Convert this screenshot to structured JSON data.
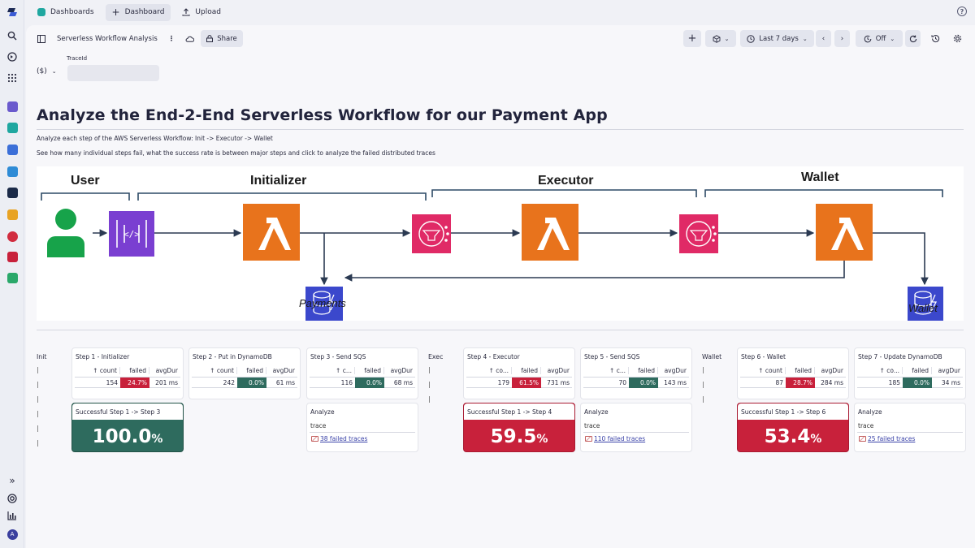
{
  "topnav": {
    "dashboards": "Dashboards",
    "dashboard": "Dashboard",
    "upload": "Upload"
  },
  "toolbar": {
    "title": "Serverless Workflow Analysis",
    "share": "Share",
    "timeframe": "Last 7 days",
    "refresh": "Off"
  },
  "variable": {
    "label": "TraceId",
    "selector": "($)",
    "value": ""
  },
  "heading": "Analyze the End-2-End Serverless Workflow for our Payment App",
  "desc1": "Analyze each step of the AWS Serverless Workflow: Init -> Executor -> Wallet",
  "desc2": "See how many individual steps fail, what the success rate is between major steps and click to analyze the failed distributed traces",
  "diagram": {
    "user": "User",
    "initializer": "Initializer",
    "executor": "Executor",
    "wallet": "Wallet",
    "payments": "Payments",
    "wallet_db": "Wallet"
  },
  "groups": [
    "Init",
    "Exec",
    "Wallet"
  ],
  "table_headers": {
    "count": "count",
    "failed": "failed",
    "avgdur": "avgDur"
  },
  "steps": [
    {
      "title": "Step 1 - Initializer",
      "count_hdr": "count",
      "count": "154",
      "failed": "24.7%",
      "avgdur": "201 ms",
      "status": "bad"
    },
    {
      "title": "Step 2 - Put in DynamoDB",
      "count_hdr": "count",
      "count": "242",
      "failed": "0.0%",
      "avgdur": "61 ms",
      "status": "good"
    },
    {
      "title": "Step 3 - Send SQS",
      "count_hdr": "c...",
      "count": "116",
      "failed": "0.0%",
      "avgdur": "68 ms",
      "status": "good"
    },
    {
      "title": "Step 4 - Executor",
      "count_hdr": "co...",
      "count": "179",
      "failed": "61.5%",
      "avgdur": "731 ms",
      "status": "bad"
    },
    {
      "title": "Step 5 - Send SQS",
      "count_hdr": "c...",
      "count": "70",
      "failed": "0.0%",
      "avgdur": "143 ms",
      "status": "good"
    },
    {
      "title": "Step 6 - Wallet",
      "count_hdr": "count",
      "count": "87",
      "failed": "28.7%",
      "avgdur": "284 ms",
      "status": "bad"
    },
    {
      "title": "Step 7 - Update DynamoDB",
      "count_hdr": "co...",
      "count": "185",
      "failed": "0.0%",
      "avgdur": "34 ms",
      "status": "good"
    }
  ],
  "success": [
    {
      "title": "Successful Step 1 -> Step 3",
      "value": "100.0",
      "unit": "%",
      "status": "good"
    },
    {
      "title": "Successful Step 1 -> Step 4",
      "value": "59.5",
      "unit": "%",
      "status": "bad"
    },
    {
      "title": "Successful Step 1 -> Step 6",
      "value": "53.4",
      "unit": "%",
      "status": "bad"
    }
  ],
  "analyze": [
    {
      "title": "Analyze",
      "column": "trace",
      "link": "38 failed traces"
    },
    {
      "title": "Analyze",
      "column": "trace",
      "link": "110 failed traces"
    },
    {
      "title": "Analyze",
      "column": "trace",
      "link": "25 failed traces"
    }
  ],
  "colors": {
    "good": "#2e6b5e",
    "bad": "#c8213b",
    "lambda": "#e8731c",
    "sqs": "#e02a66",
    "dynamo": "#3b48cc",
    "gateway": "#7a3fd1",
    "user": "#17a34a",
    "ink": "#2b3a52"
  }
}
